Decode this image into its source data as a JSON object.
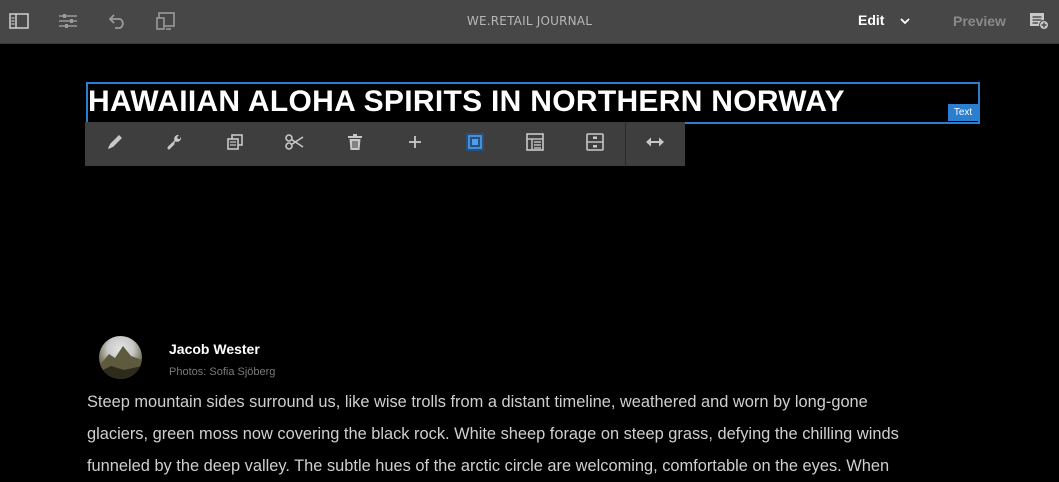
{
  "toolbar": {
    "title": "WE.RETAIL JOURNAL",
    "mode": "Edit",
    "preview_label": "Preview",
    "icons": [
      "side-panel-icon",
      "page-properties-icon",
      "undo-icon",
      "emulator-icon",
      "annotate-icon",
      "chevron-down-icon"
    ]
  },
  "article": {
    "heading": "HAWAIIAN ALOHA SPIRITS IN NORTHERN NORWAY",
    "component_badge": "Text",
    "author": "Jacob Wester",
    "photo_credit": "Photos: Sofia Sjöberg",
    "body_lines": [
      "Steep mountain sides surround us, like wise trolls from a distant timeline, weathered and worn by long-gone",
      "glaciers, green moss now covering the black rock. White sheep forage on steep grass, defying the chilling winds",
      "funneled by the deep valley. The subtle hues of the arctic circle are welcoming, comfortable on the eyes. When"
    ]
  },
  "edit_toolbar": {
    "icons": [
      "edit-icon",
      "configure-icon",
      "copy-icon",
      "cut-icon",
      "delete-icon",
      "insert-icon",
      "group-icon",
      "layout-icon",
      "parent-icon",
      "drag-icon"
    ]
  },
  "colors": {
    "topbar": "#474747",
    "selection": "#2b7fd0",
    "editbar": "#3e3e3e"
  }
}
